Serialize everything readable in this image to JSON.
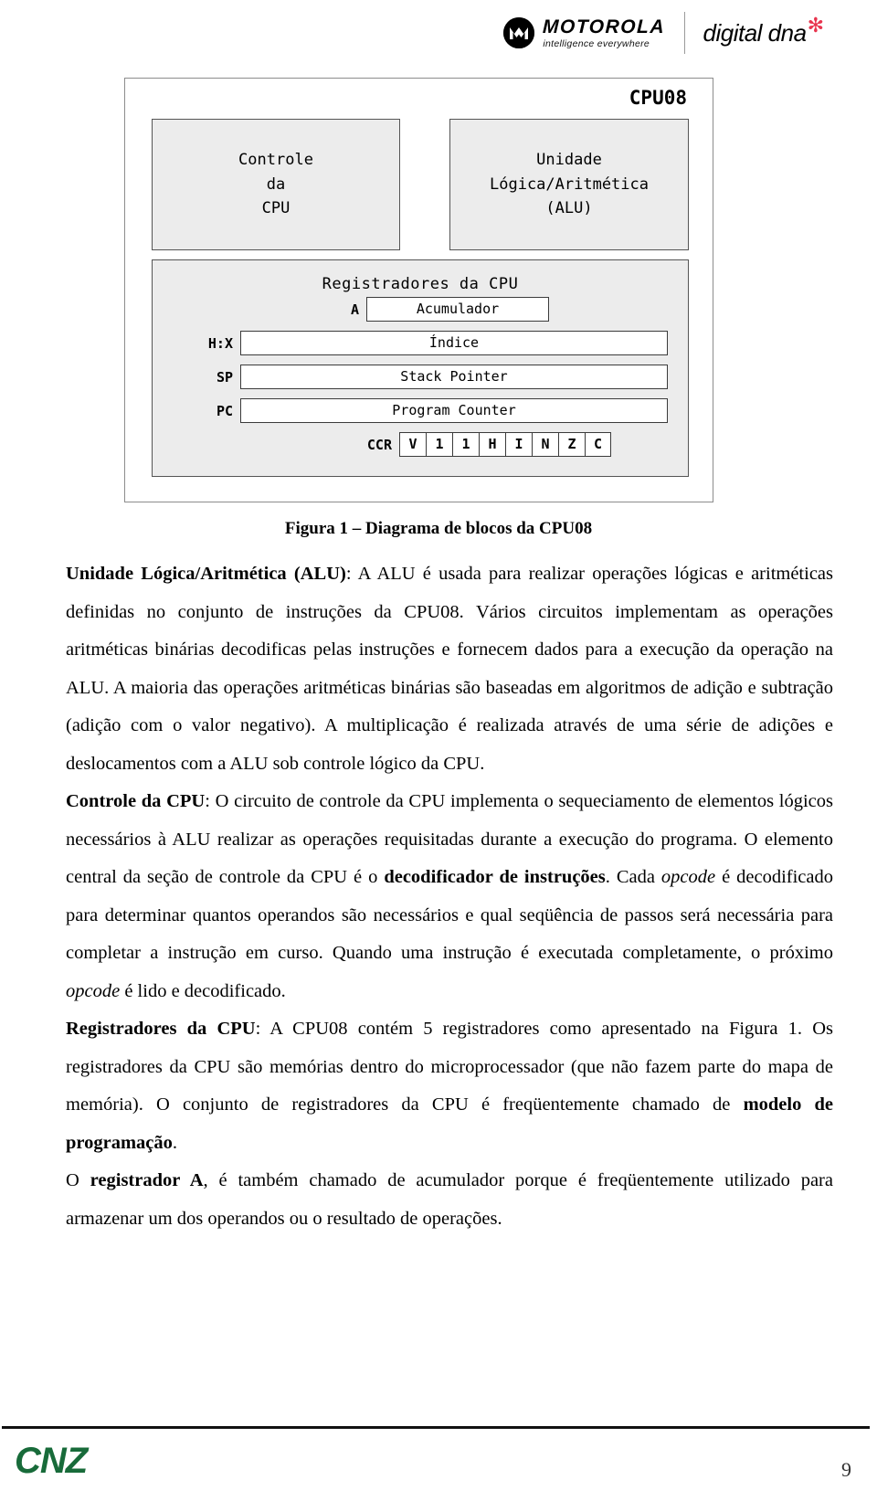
{
  "header": {
    "motorola_name": "MOTOROLA",
    "motorola_tagline": "intelligence everywhere",
    "digitaldna_text": "digital dna",
    "star_glyph": "✻",
    "tm_glyph": "™"
  },
  "figure": {
    "title": "CPU08",
    "control_block": "Controle\nda\nCPU",
    "alu_block": "Unidade\nLógica/Aritmética\n(ALU)",
    "registers_title": "Registradores da CPU",
    "registers": [
      {
        "label": "A",
        "name": "Acumulador"
      },
      {
        "label": "H:X",
        "name": "Índice"
      },
      {
        "label": "SP",
        "name": "Stack Pointer"
      },
      {
        "label": "PC",
        "name": "Program Counter"
      }
    ],
    "ccr_label": "CCR",
    "ccr_bits": [
      "V",
      "1",
      "1",
      "H",
      "I",
      "N",
      "Z",
      "C"
    ],
    "caption": "Figura 1 – Diagrama de blocos da CPU08"
  },
  "content": {
    "p1_heading": "Unidade Lógica/Aritmética (ALU)",
    "p1_body": ": A ALU é usada para realizar operações lógicas e aritméticas definidas no conjunto de instruções da CPU08. Vários circuitos implementam as operações aritméticas binárias decodificas pelas instruções e fornecem dados para a execução da operação na ALU. A maioria das operações aritméticas binárias são baseadas em algoritmos de adição e subtração (adição com o valor negativo). A multiplicação é realizada através de uma série de adições e deslocamentos com a ALU sob controle lógico da CPU.",
    "p2_heading": "Controle da CPU",
    "p2_body_a": ": O circuito de controle da CPU implementa o sequeciamento de elementos lógicos necessários à ALU realizar as operações requisitadas durante a execução do programa. O elemento central da seção de controle da CPU é o ",
    "p2_bold2": "decodificador de instruções",
    "p2_body_b": ".  Cada ",
    "p2_italic1": "opcode",
    "p2_body_c": " é decodificado para determinar quantos operandos são necessários e qual seqüência de passos será necessária para completar a instrução em curso. Quando uma instrução é executada completamente, o próximo ",
    "p2_italic2": "opcode",
    "p2_body_d": " é lido e decodificado.",
    "p3_heading": "Registradores da CPU",
    "p3_body_a": ": A CPU08 contém 5 registradores como apresentado na Figura 1. Os registradores da CPU são memórias dentro do microprocessador (que não fazem parte do mapa de memória). O conjunto de registradores da CPU é freqüentemente chamado de ",
    "p3_bold2": "modelo de programação",
    "p3_body_b": ".",
    "p4_lead": "O ",
    "p4_bold": "registrador A",
    "p4_body": ", é também chamado de acumulador porque é freqüentemente utilizado para armazenar um dos operandos ou o resultado de operações."
  },
  "footer": {
    "logo_text": "CNZ",
    "logo_color": "#186b3a",
    "page_number": "9"
  }
}
